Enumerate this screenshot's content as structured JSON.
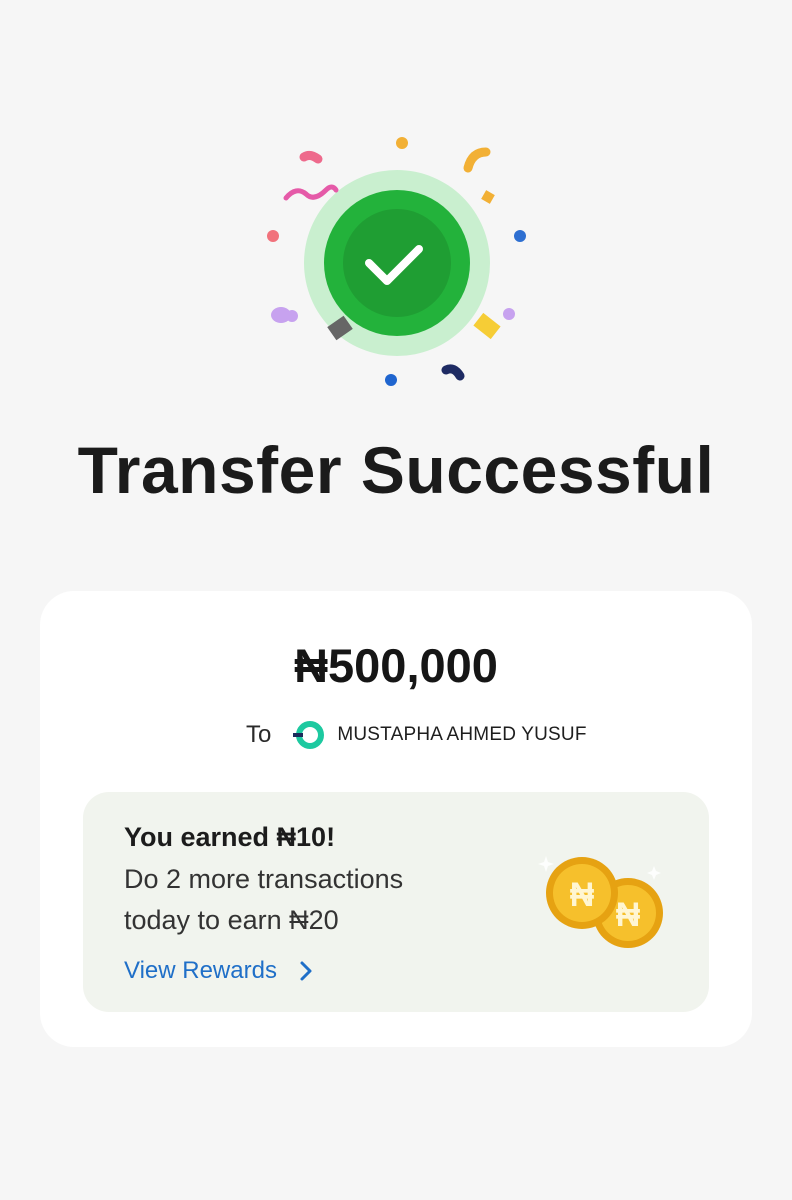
{
  "status": {
    "title": "Transfer Successful",
    "icons": [
      "checkmark-icon",
      "confetti"
    ]
  },
  "transaction": {
    "amount": "₦500,000",
    "to_label": "To",
    "recipient_name": "MUSTAPHA AHMED YUSUF",
    "bank_icon": "opay-logo-icon"
  },
  "rewards": {
    "title": "You earned ₦10!",
    "line1": "Do 2 more transactions",
    "line2": "today to earn ₦20",
    "link_label": "View Rewards",
    "link_icon": "chevron-right-icon",
    "illustration": "naira-coins-icon"
  },
  "colors": {
    "background": "#f6f6f6",
    "card": "#ffffff",
    "success_green": "#22b33a",
    "link_blue": "#1f6fc8",
    "reward_box": "#f1f4ee",
    "coin_gold": "#f4b81c"
  }
}
